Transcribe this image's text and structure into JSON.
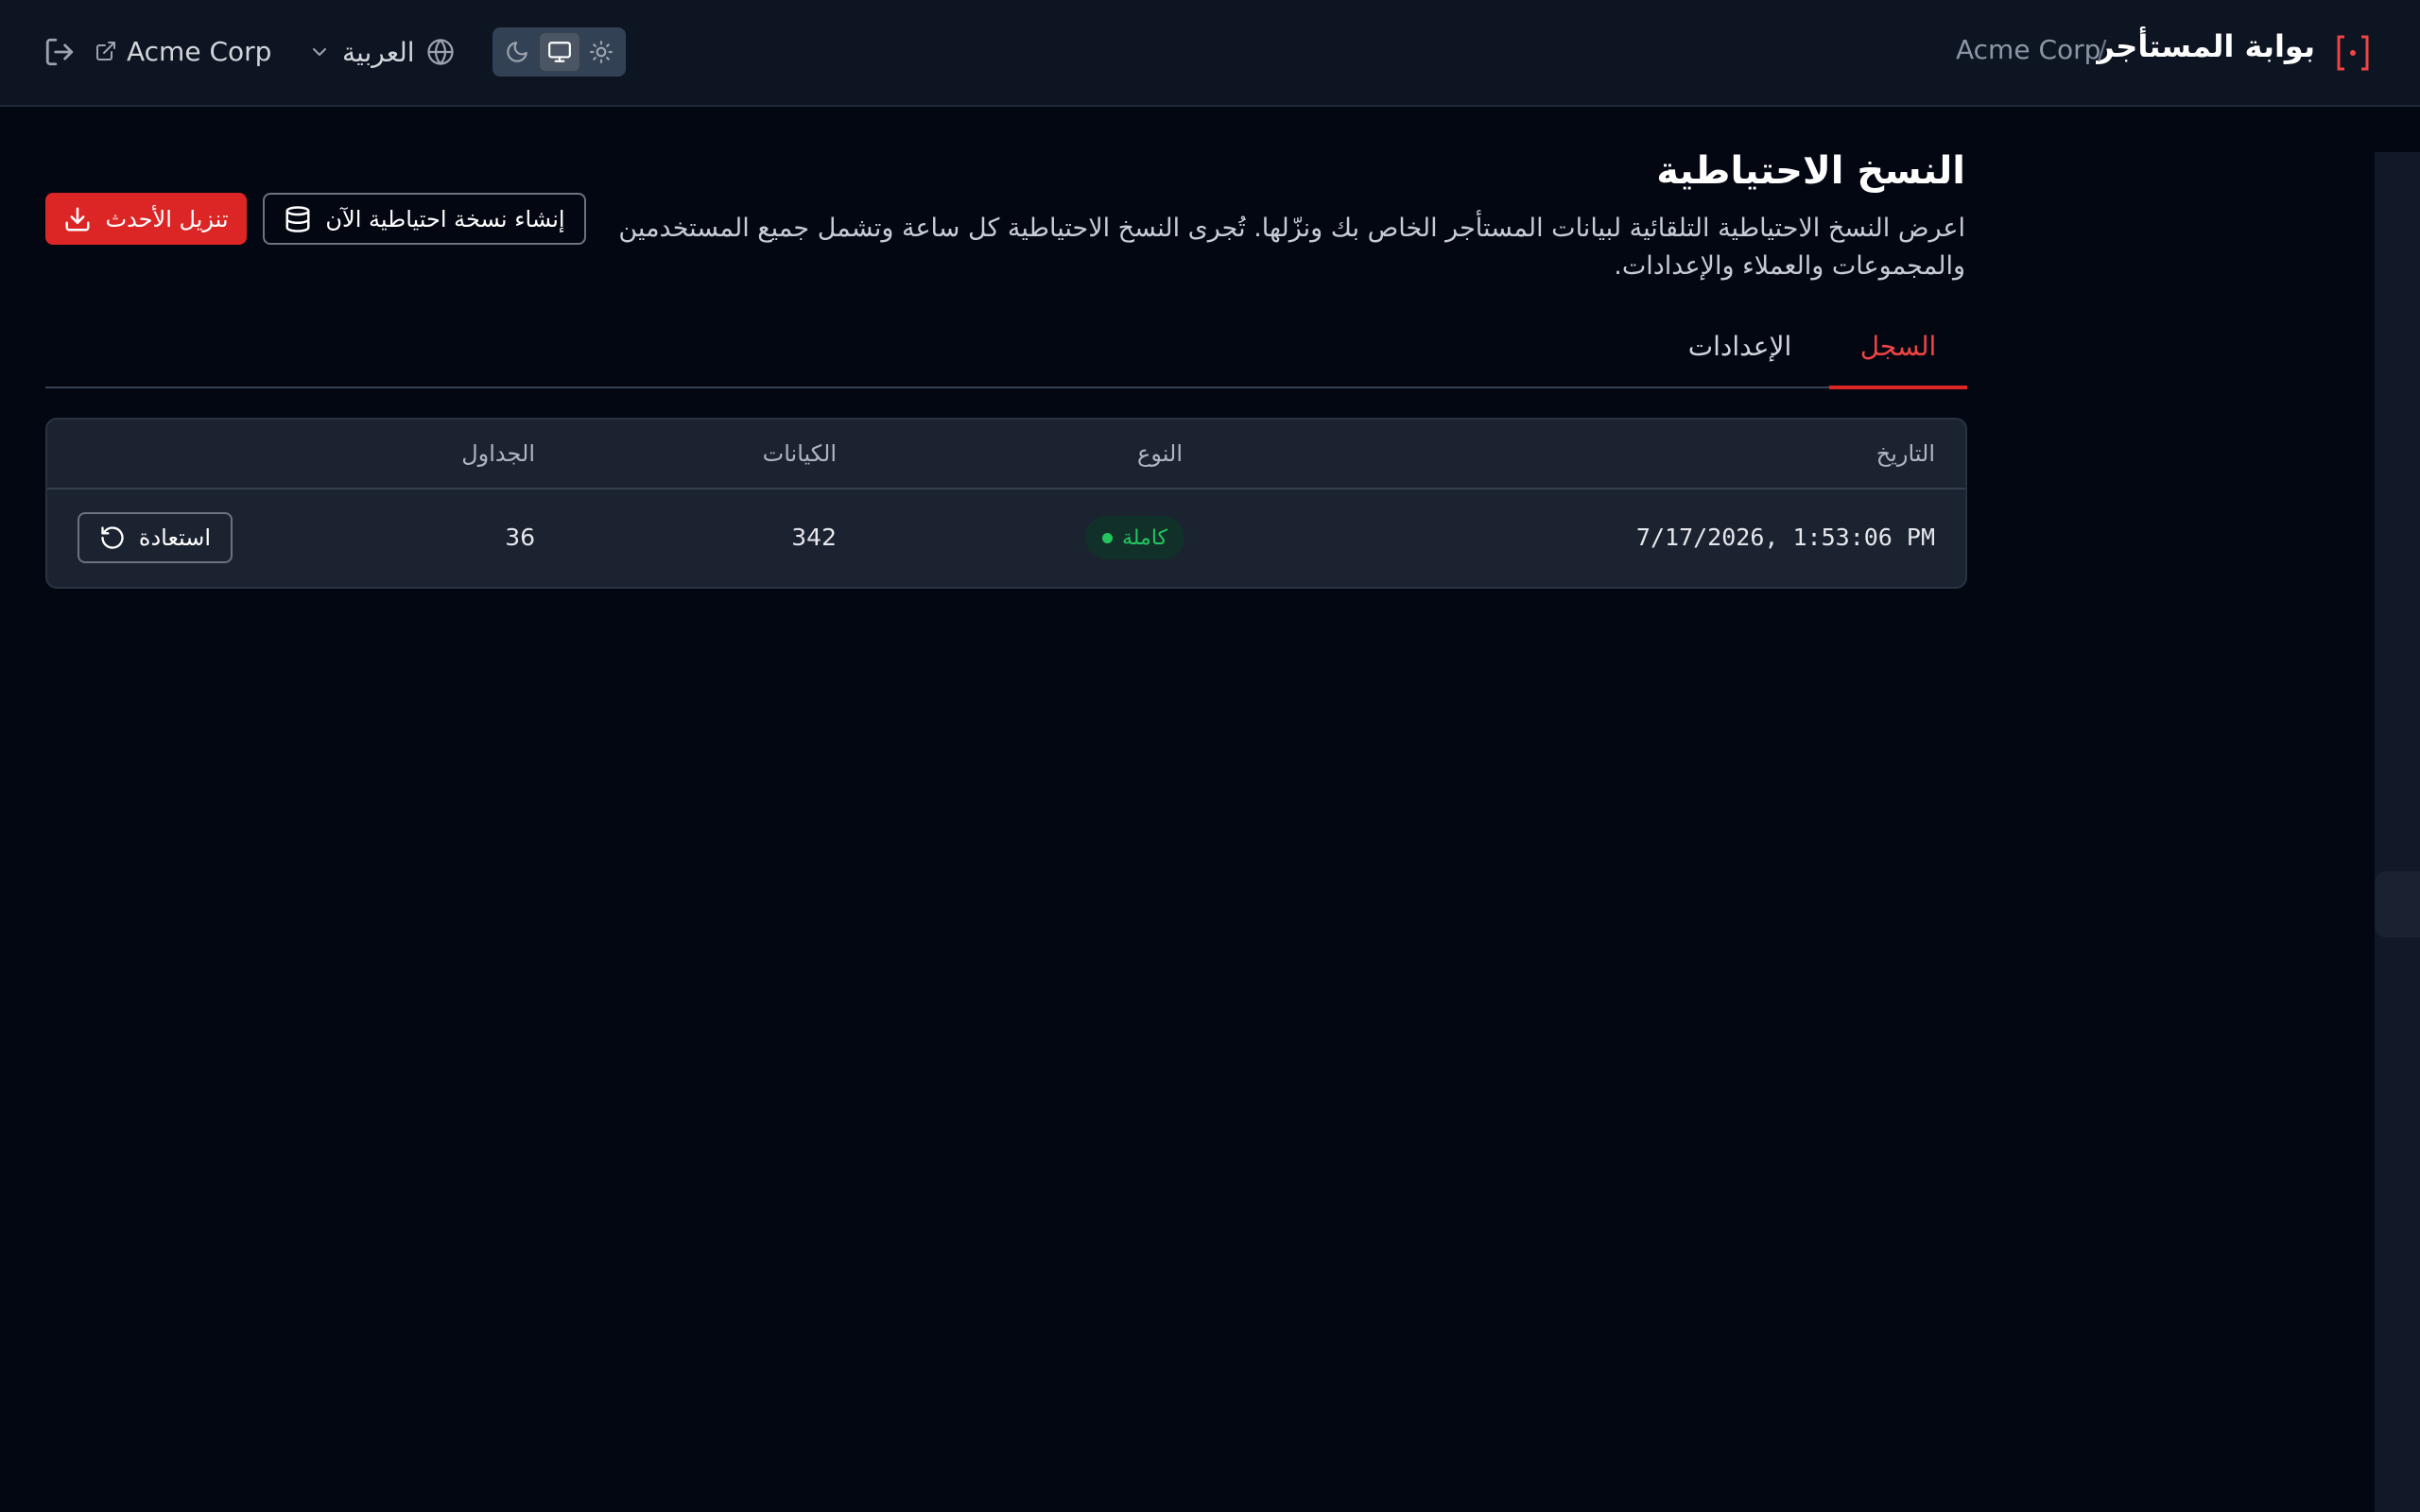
{
  "header": {
    "brand_title": "بوابة المستأجر",
    "breadcrumb_separator": "/",
    "tenant_name": "Acme Corp",
    "tenant_link_label": "Acme Corp",
    "language_label": "العربية",
    "theme_options": [
      "dark",
      "system",
      "light"
    ],
    "theme_selected": "system",
    "icons": {
      "logo": "bracket-dot-logo-icon",
      "logout": "logout-icon",
      "external": "external-link-icon",
      "language": "globe-icon",
      "dropdown": "chevron-down-icon",
      "dark": "moon-icon",
      "system": "monitor-icon",
      "light": "sun-icon"
    }
  },
  "page": {
    "title": "النسخ الاحتياطية",
    "description": "اعرض النسخ الاحتياطية التلقائية لبيانات المستأجر الخاص بك ونزّلها. تُجرى النسخ الاحتياطية كل ساعة وتشمل جميع المستخدمين والمجموعات والعملاء والإعدادات.",
    "actions": {
      "create_label": "إنشاء نسخة احتياطية الآن",
      "download_label": "تنزيل الأحدث"
    }
  },
  "tabs": [
    {
      "label": "السجل",
      "active": true
    },
    {
      "label": "الإعدادات",
      "active": false
    }
  ],
  "table": {
    "columns": {
      "date": "التاريخ",
      "type": "النوع",
      "entities": "الكيانات",
      "tables": "الجداول"
    },
    "rows": [
      {
        "date": "7/17/2026, 1:53:06 PM",
        "type": "كاملة",
        "type_status": "success",
        "entities": "342",
        "tables": "36",
        "restore_label": "استعادة"
      }
    ]
  },
  "colors": {
    "accent": "#dc2626",
    "background": "#030712",
    "header_bg": "#0e1522",
    "card_bg": "#1b2230",
    "success": "#22c55e"
  }
}
